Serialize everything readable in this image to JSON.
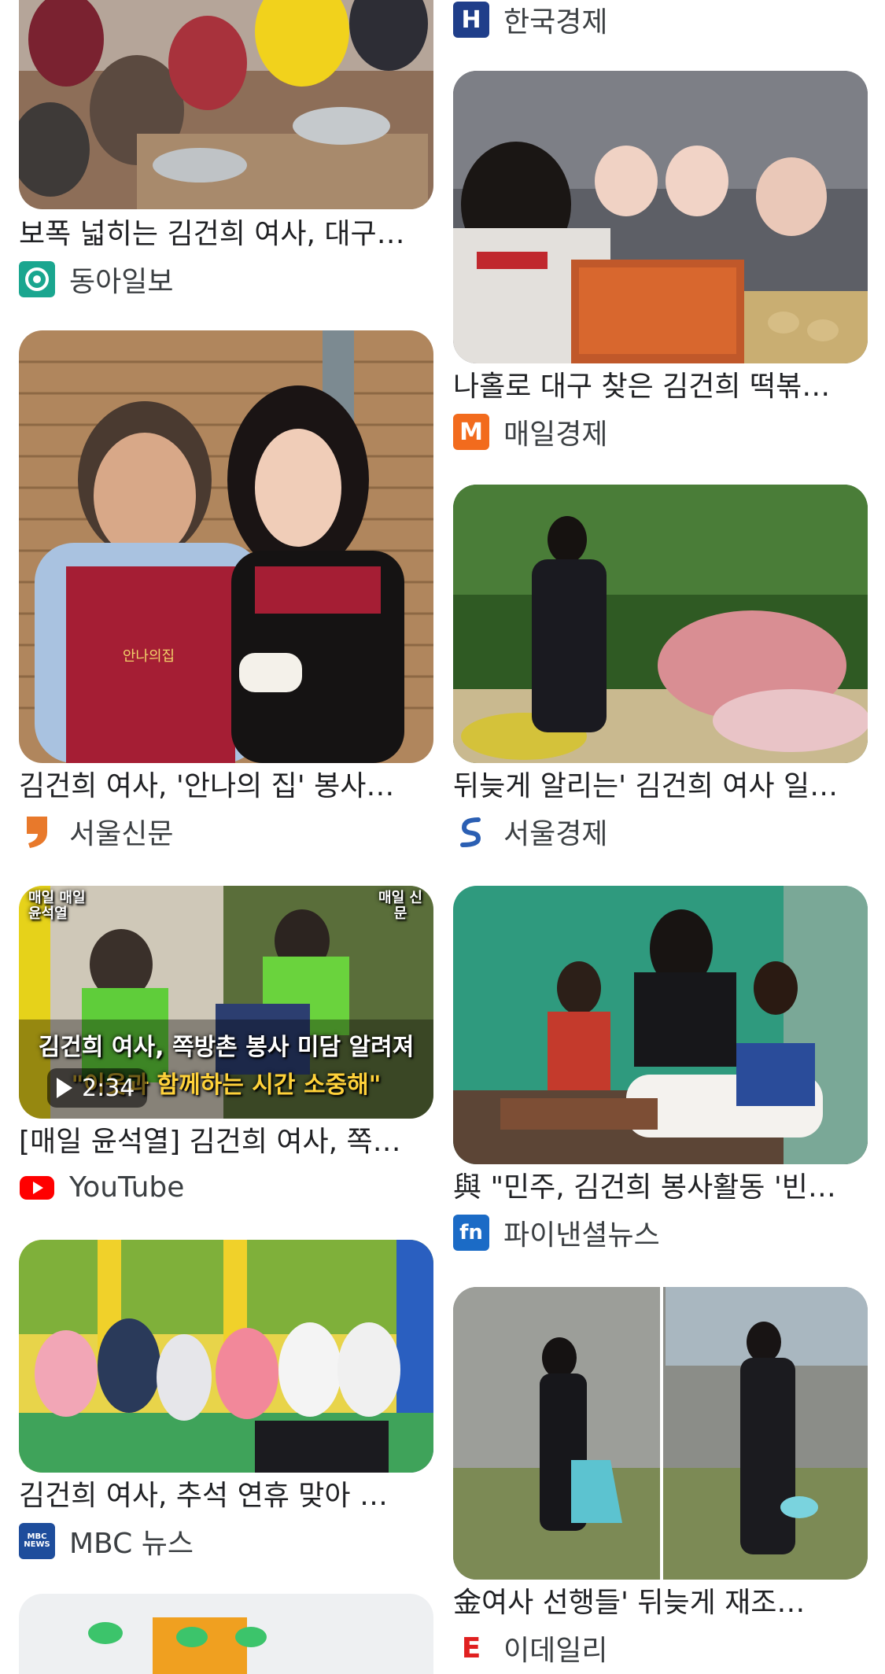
{
  "left": [
    {
      "title": "보폭 넓히는 김건희 여사, 대구…",
      "source": "동아일보"
    },
    {
      "title": "김건희 여사, '안나의 집' 봉사…",
      "source": "서울신문",
      "apron_text": "안나의집"
    },
    {
      "title": "[매일 윤석열] 김건희 여사, 쪽…",
      "source": "YouTube",
      "duration": "2:34",
      "overlay_top_left": "매일 매일 윤석열",
      "overlay_top_right": "매일 신문",
      "overlay_line1": "김건희 여사, 쪽방촌 봉사 미담 알려져",
      "overlay_line2": "\"이웃과 함께하는 시간 소중해\""
    },
    {
      "title": "김건희 여사, 추석 연휴 맞아 …",
      "source": "MBC 뉴스"
    },
    {
      "title": "",
      "source": ""
    }
  ],
  "right": [
    {
      "title": "",
      "source": "한국경제"
    },
    {
      "title": "나홀로 대구 찾은 김건희 떡볶…",
      "source": "매일경제"
    },
    {
      "title": "뒤늦게 알리는' 김건희 여사 일…",
      "source": "서울경제"
    },
    {
      "title": "與 \"민주, 김건희 봉사활동 '빈…",
      "source": "파이낸셜뉴스"
    },
    {
      "title": "金여사 선행들' 뒤늦게 재조…",
      "source": "이데일리"
    }
  ],
  "logos": {
    "donga": {
      "letter": "",
      "color": "#1aa68f"
    },
    "seoul_shinmun": {
      "letter": "",
      "color": "#e8792b"
    },
    "youtube": {
      "letter": "",
      "color": "#ff0000"
    },
    "mbc": {
      "letter": "MBC NEWS",
      "color": "#1e4d9c"
    },
    "hankyung": {
      "letter": "H",
      "color": "#1f3e8a"
    },
    "mk": {
      "letter": "M",
      "color": "#f26b1d"
    },
    "sedaily": {
      "letter": "S",
      "color": "#2b5fb3"
    },
    "fnnews": {
      "letter": "fn",
      "color": "#1b6bc6"
    },
    "edaily": {
      "letter": "E",
      "color": "#e02020"
    }
  }
}
